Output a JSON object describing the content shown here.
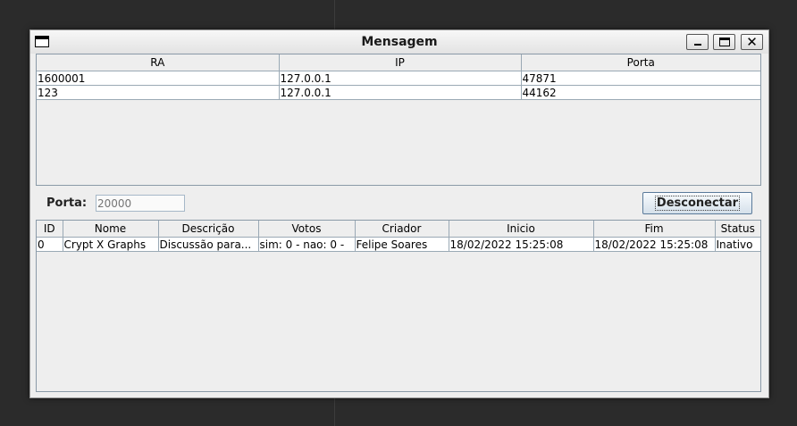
{
  "window": {
    "title": "Mensagem"
  },
  "clients_table": {
    "columns": [
      "RA",
      "IP",
      "Porta"
    ],
    "rows": [
      [
        "1600001",
        "127.0.0.1",
        "47871"
      ],
      [
        "123",
        "127.0.0.1",
        "44162"
      ]
    ]
  },
  "controls": {
    "porta_label": "Porta:",
    "porta_placeholder": "20000",
    "disconnect_label": "Desconectar"
  },
  "discussions_table": {
    "columns": [
      "ID",
      "Nome",
      "Descrição",
      "Votos",
      "Criador",
      "Inicio",
      "Fim",
      "Status"
    ],
    "rows": [
      [
        "0",
        "Crypt X Graphs",
        "Discussão para...",
        "sim: 0 - nao: 0 -",
        "Felipe Soares",
        "18/02/2022 15:25:08",
        "18/02/2022 15:25:08",
        "Inativo"
      ]
    ]
  }
}
